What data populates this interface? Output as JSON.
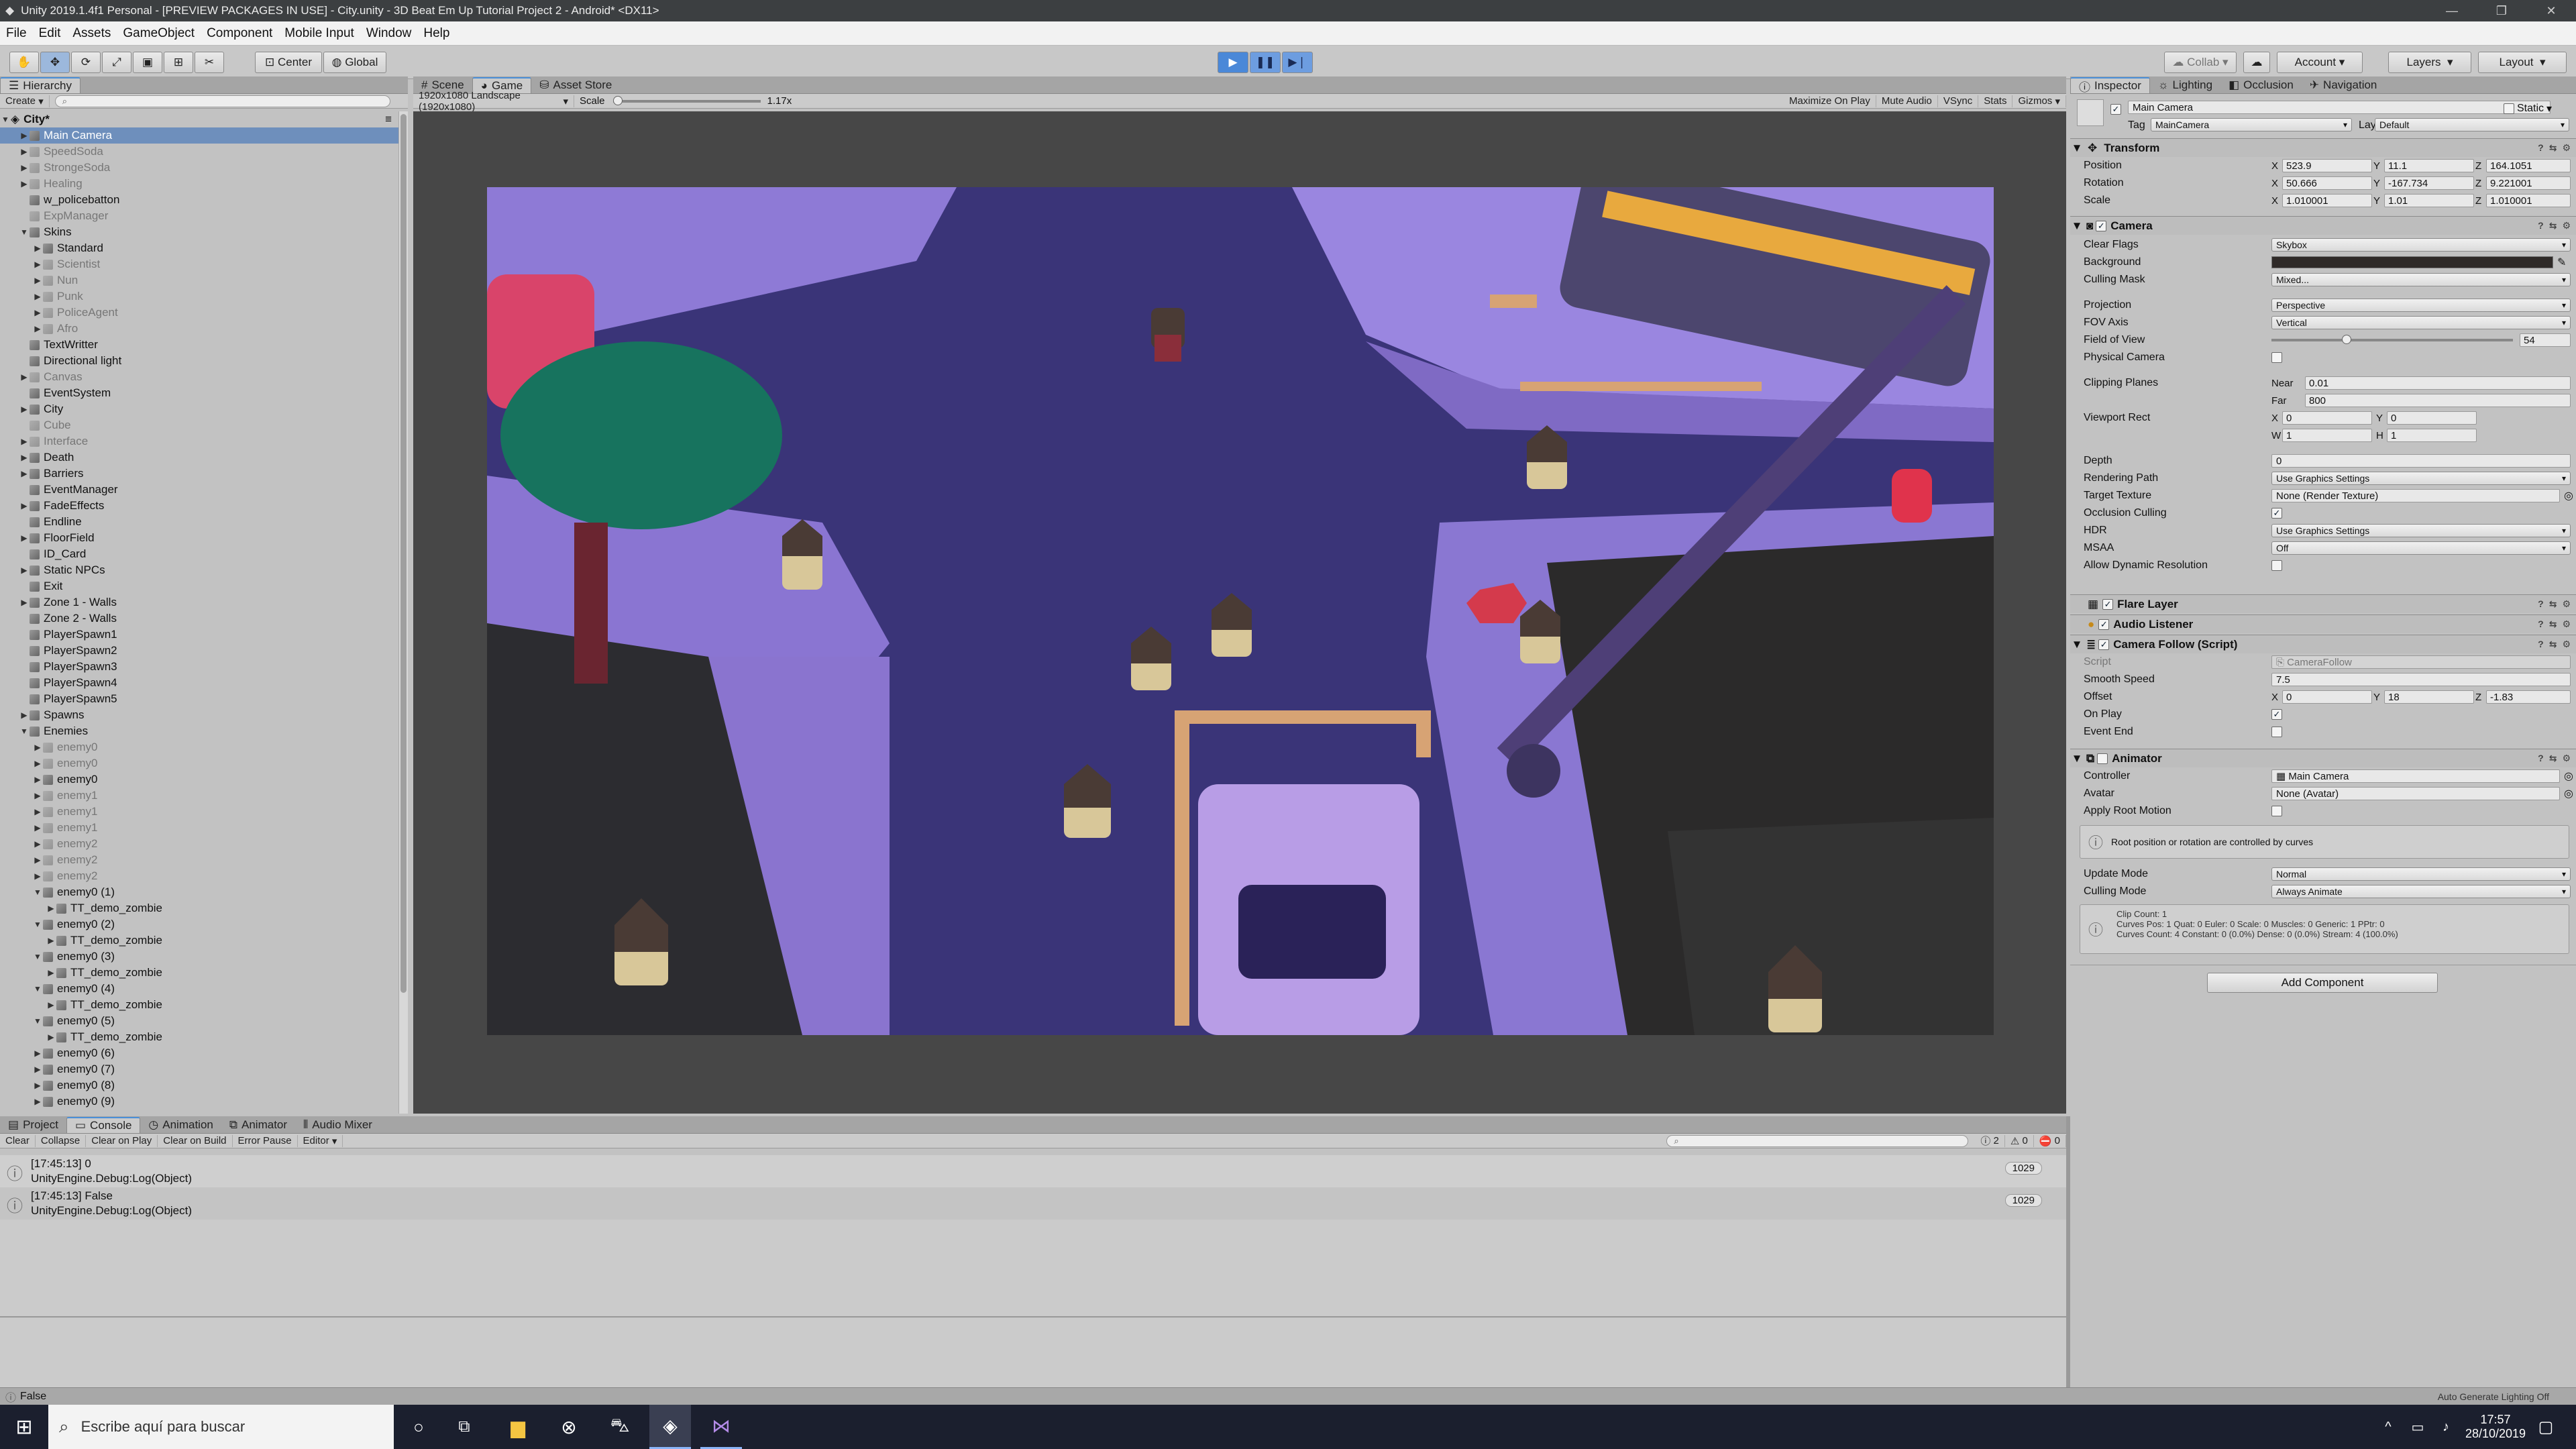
{
  "window": {
    "title": "Unity 2019.1.4f1 Personal - [PREVIEW PACKAGES IN USE] - City.unity - 3D Beat Em Up Tutorial Project 2 - Android* <DX11>"
  },
  "menu": [
    "File",
    "Edit",
    "Assets",
    "GameObject",
    "Component",
    "Mobile Input",
    "Window",
    "Help"
  ],
  "toolbar": {
    "center": "Center",
    "global": "Global",
    "collab": "Collab",
    "account": "Account",
    "layers": "Layers",
    "layout": "Layout"
  },
  "hierarchy": {
    "tab": "Hierarchy",
    "create": "Create",
    "scene": "City*",
    "items": [
      {
        "label": "Main Camera",
        "indent": 1,
        "arrow": "▶",
        "sel": true
      },
      {
        "label": "SpeedSoda",
        "indent": 1,
        "arrow": "▶",
        "dis": true
      },
      {
        "label": "StrongeSoda",
        "indent": 1,
        "arrow": "▶",
        "dis": true
      },
      {
        "label": "Healing",
        "indent": 1,
        "arrow": "▶",
        "dis": true
      },
      {
        "label": "w_policebatton",
        "indent": 1,
        "arrow": ""
      },
      {
        "label": "ExpManager",
        "indent": 1,
        "arrow": "",
        "dis": true
      },
      {
        "label": "Skins",
        "indent": 1,
        "arrow": "▼"
      },
      {
        "label": "Standard",
        "indent": 2,
        "arrow": "▶"
      },
      {
        "label": "Scientist",
        "indent": 2,
        "arrow": "▶",
        "dis": true
      },
      {
        "label": "Nun",
        "indent": 2,
        "arrow": "▶",
        "dis": true
      },
      {
        "label": "Punk",
        "indent": 2,
        "arrow": "▶",
        "dis": true
      },
      {
        "label": "PoliceAgent",
        "indent": 2,
        "arrow": "▶",
        "dis": true
      },
      {
        "label": "Afro",
        "indent": 2,
        "arrow": "▶",
        "dis": true
      },
      {
        "label": "TextWritter",
        "indent": 1,
        "arrow": ""
      },
      {
        "label": "Directional light",
        "indent": 1,
        "arrow": ""
      },
      {
        "label": "Canvas",
        "indent": 1,
        "arrow": "▶",
        "dis": true
      },
      {
        "label": "EventSystem",
        "indent": 1,
        "arrow": ""
      },
      {
        "label": "City",
        "indent": 1,
        "arrow": "▶"
      },
      {
        "label": "Cube",
        "indent": 1,
        "arrow": "",
        "dis": true
      },
      {
        "label": "Interface",
        "indent": 1,
        "arrow": "▶",
        "dis": true
      },
      {
        "label": "Death",
        "indent": 1,
        "arrow": "▶"
      },
      {
        "label": "Barriers",
        "indent": 1,
        "arrow": "▶"
      },
      {
        "label": "EventManager",
        "indent": 1,
        "arrow": ""
      },
      {
        "label": "FadeEffects",
        "indent": 1,
        "arrow": "▶"
      },
      {
        "label": "Endline",
        "indent": 1,
        "arrow": ""
      },
      {
        "label": "FloorField",
        "indent": 1,
        "arrow": "▶"
      },
      {
        "label": "ID_Card",
        "indent": 1,
        "arrow": ""
      },
      {
        "label": "Static NPCs",
        "indent": 1,
        "arrow": "▶"
      },
      {
        "label": "Exit",
        "indent": 1,
        "arrow": ""
      },
      {
        "label": "Zone 1 - Walls",
        "indent": 1,
        "arrow": "▶"
      },
      {
        "label": "Zone 2 - Walls",
        "indent": 1,
        "arrow": ""
      },
      {
        "label": "PlayerSpawn1",
        "indent": 1,
        "arrow": ""
      },
      {
        "label": "PlayerSpawn2",
        "indent": 1,
        "arrow": ""
      },
      {
        "label": "PlayerSpawn3",
        "indent": 1,
        "arrow": ""
      },
      {
        "label": "PlayerSpawn4",
        "indent": 1,
        "arrow": ""
      },
      {
        "label": "PlayerSpawn5",
        "indent": 1,
        "arrow": ""
      },
      {
        "label": "Spawns",
        "indent": 1,
        "arrow": "▶"
      },
      {
        "label": "Enemies",
        "indent": 1,
        "arrow": "▼"
      },
      {
        "label": "enemy0",
        "indent": 2,
        "arrow": "▶",
        "dis": true
      },
      {
        "label": "enemy0",
        "indent": 2,
        "arrow": "▶",
        "dis": true
      },
      {
        "label": "enemy0",
        "indent": 2,
        "arrow": "▶"
      },
      {
        "label": "enemy1",
        "indent": 2,
        "arrow": "▶",
        "dis": true
      },
      {
        "label": "enemy1",
        "indent": 2,
        "arrow": "▶",
        "dis": true
      },
      {
        "label": "enemy1",
        "indent": 2,
        "arrow": "▶",
        "dis": true
      },
      {
        "label": "enemy2",
        "indent": 2,
        "arrow": "▶",
        "dis": true
      },
      {
        "label": "enemy2",
        "indent": 2,
        "arrow": "▶",
        "dis": true
      },
      {
        "label": "enemy2",
        "indent": 2,
        "arrow": "▶",
        "dis": true
      },
      {
        "label": "enemy0 (1)",
        "indent": 2,
        "arrow": "▼"
      },
      {
        "label": "TT_demo_zombie",
        "indent": 3,
        "arrow": "▶"
      },
      {
        "label": "enemy0 (2)",
        "indent": 2,
        "arrow": "▼"
      },
      {
        "label": "TT_demo_zombie",
        "indent": 3,
        "arrow": "▶"
      },
      {
        "label": "enemy0 (3)",
        "indent": 2,
        "arrow": "▼"
      },
      {
        "label": "TT_demo_zombie",
        "indent": 3,
        "arrow": "▶"
      },
      {
        "label": "enemy0 (4)",
        "indent": 2,
        "arrow": "▼"
      },
      {
        "label": "TT_demo_zombie",
        "indent": 3,
        "arrow": "▶"
      },
      {
        "label": "enemy0 (5)",
        "indent": 2,
        "arrow": "▼"
      },
      {
        "label": "TT_demo_zombie",
        "indent": 3,
        "arrow": "▶"
      },
      {
        "label": "enemy0 (6)",
        "indent": 2,
        "arrow": "▶"
      },
      {
        "label": "enemy0 (7)",
        "indent": 2,
        "arrow": "▶"
      },
      {
        "label": "enemy0 (8)",
        "indent": 2,
        "arrow": "▶"
      },
      {
        "label": "enemy0 (9)",
        "indent": 2,
        "arrow": "▶"
      }
    ]
  },
  "view": {
    "tabs": [
      "Scene",
      "Game",
      "Asset Store"
    ],
    "resolution": "1920x1080 Landscape (1920x1080)",
    "scale_label": "Scale",
    "scale_value": "1.17x",
    "options": [
      "Maximize On Play",
      "Mute Audio",
      "VSync",
      "Stats",
      "Gizmos"
    ]
  },
  "inspector": {
    "tabs": [
      "Inspector",
      "Lighting",
      "Occlusion",
      "Navigation"
    ],
    "object_name": "Main Camera",
    "static": "Static",
    "tag_label": "Tag",
    "tag": "MainCamera",
    "layer_label": "Layer",
    "layer": "Default",
    "transform": {
      "title": "Transform",
      "position": [
        "523.9",
        "11.1",
        "164.1051"
      ],
      "rotation": [
        "50.666",
        "-167.734",
        "9.221001"
      ],
      "scale": [
        "1.010001",
        "1.01",
        "1.010001"
      ]
    },
    "camera": {
      "title": "Camera",
      "clear_flags": "Skybox",
      "culling_mask": "Mixed...",
      "projection": "Perspective",
      "fov_axis": "Vertical",
      "fov": "54",
      "near": "0.01",
      "far": "800",
      "vx": "0",
      "vy": "0",
      "vw": "1",
      "vh": "1",
      "depth": "0",
      "rendering_path": "Use Graphics Settings",
      "target_texture": "None (Render Texture)",
      "hdr": "Use Graphics Settings",
      "msaa": "Off"
    },
    "flare": "Flare Layer",
    "audio": "Audio Listener",
    "follow": {
      "title": "Camera Follow (Script)",
      "script": "CameraFollow",
      "smooth": "7.5",
      "ox": "0",
      "oy": "18",
      "oz": "-1.83"
    },
    "animator": {
      "title": "Animator",
      "controller": "Main Camera",
      "avatar": "None (Avatar)",
      "note": "Root position or rotation are controlled by curves",
      "update_mode": "Normal",
      "culling_mode": "Always Animate",
      "clip_info": [
        "Clip Count: 1",
        "Curves Pos: 1 Quat: 0 Euler: 0 Scale: 0 Muscles: 0 Generic: 1 PPtr: 0",
        "Curves Count: 4 Constant: 0 (0.0%) Dense: 0 (0.0%) Stream: 4 (100.0%)"
      ]
    },
    "add_component": "Add Component"
  },
  "bottom": {
    "tabs": [
      "Project",
      "Console",
      "Animation",
      "Animator",
      "Audio Mixer"
    ],
    "buttons": [
      "Clear",
      "Collapse",
      "Clear on Play",
      "Clear on Build",
      "Error Pause",
      "Editor"
    ],
    "counts": [
      "2",
      "0",
      "0"
    ],
    "logs": [
      {
        "l1": "[17:45:13] 0",
        "l2": "UnityEngine.Debug:Log(Object)",
        "count": "1029"
      },
      {
        "l1": "[17:45:13] False",
        "l2": "UnityEngine.Debug:Log(Object)",
        "count": "1029"
      }
    ]
  },
  "status": {
    "message": "False",
    "right": "Auto Generate Lighting Off"
  },
  "taskbar": {
    "search": "Escribe aquí para buscar",
    "time": "17:57",
    "date": "28/10/2019"
  }
}
